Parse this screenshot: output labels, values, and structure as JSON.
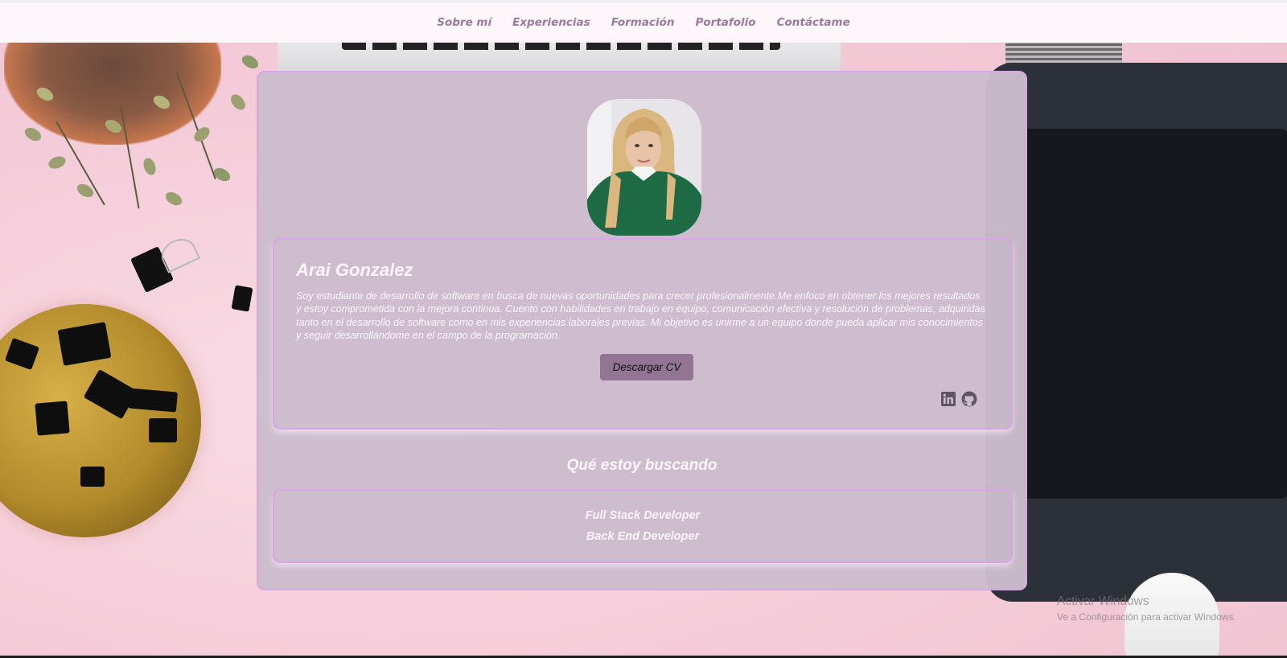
{
  "nav": {
    "items": [
      "Sobre mí",
      "Experiencias",
      "Formación",
      "Portafolio",
      "Contáctame"
    ]
  },
  "profile": {
    "name": "Arai Gonzalez",
    "bio": "Soy estudiante de desarrollo de software en busca de nuevas oportunidades para crecer profesionalmente.Me enfoco en obtener los mejores resultados y estoy comprometida con la mejora continua. Cuento con habilidades en trabajo en equipo, comunicación efectiva y resolución de problemas, adquiridas tanto en el desarrollo de software como en mis experiencias laborales previas. Mi objetivo es unirme a un equipo donde pueda aplicar mis conocimientos y seguir desarrollándome en el campo de la programación.",
    "cv_button": "Descargar CV",
    "social_icons": [
      "linkedin-icon",
      "github-icon"
    ]
  },
  "seeking": {
    "title": "Qué estoy buscando",
    "items": [
      "Full Stack Developer",
      "Back End Developer"
    ]
  },
  "watermark": {
    "title": "Activar Windows",
    "subtitle": "Ve a Configuración para activar Windows."
  },
  "colors": {
    "nav_text": "#9b7a9b",
    "card_bg": "#ccbdcc",
    "card_border": "#d4a8e0",
    "button_bg": "#927493",
    "text_light": "#fdf6fb"
  }
}
